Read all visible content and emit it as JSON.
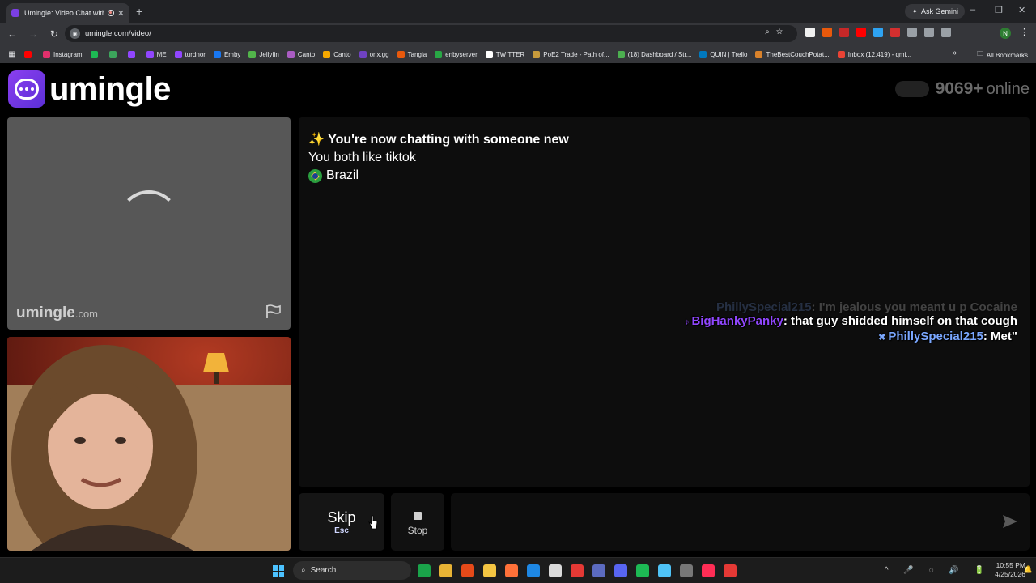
{
  "browser": {
    "tab_title": "Umingle: Video Chat with S",
    "new_tab": "+",
    "ask_gemini": "Ask Gemini",
    "url": "umingle.com/video/",
    "bookmarks": [
      {
        "label": "Instagram",
        "color": "#e1306c"
      },
      {
        "label": "",
        "color": "#1db954"
      },
      {
        "label": "",
        "color": "#3ca55c"
      },
      {
        "label": "",
        "color": "#9146ff"
      },
      {
        "label": "ME",
        "color": "#9146ff"
      },
      {
        "label": "turdnor",
        "color": "#9146ff"
      },
      {
        "label": "Emby",
        "color": "#1877f2"
      },
      {
        "label": "Jellyfin",
        "color": "#52b54b"
      },
      {
        "label": "Canto",
        "color": "#aa5cc3"
      },
      {
        "label": "Canto",
        "color": "#f6a800"
      },
      {
        "label": "onx.gg",
        "color": "#6f42c1"
      },
      {
        "label": "Tangia",
        "color": "#e8590c"
      },
      {
        "label": "enbyserver",
        "color": "#28a745"
      },
      {
        "label": "TWITTER",
        "color": "#ffffff"
      },
      {
        "label": "PoE2 Trade - Path of...",
        "color": "#c89b3c"
      },
      {
        "label": "(18) Dashboard / Str...",
        "color": "#4caf50"
      },
      {
        "label": "QUIN | Trello",
        "color": "#0079bf"
      },
      {
        "label": "TheBestCouchPotat...",
        "color": "#d9822b"
      },
      {
        "label": "Inbox (12,419) - qmi...",
        "color": "#ea4335"
      }
    ],
    "all_bookmarks": "All Bookmarks"
  },
  "header": {
    "logo_text": "umingle",
    "online_count": "9069+",
    "online_label": "online"
  },
  "remote_video": {
    "watermark": "umingle",
    "watermark_domain": ".com"
  },
  "chat": {
    "system_lines": [
      "✨ You're now chatting with someone new",
      "You both like tiktok",
      "Brazil"
    ],
    "overlay_messages": [
      {
        "user": "PhillySpecial215",
        "text": ": I'm jealous you meant u p Cocaine",
        "faded": true
      },
      {
        "user": "BigHankyPanky",
        "text": ": that guy shidded himself on that cough",
        "faded": false
      },
      {
        "user": "PhillySpecial215",
        "text": ": Met\"",
        "faded": false
      }
    ]
  },
  "controls": {
    "skip_label": "Skip",
    "skip_key": "Esc",
    "stop_label": "Stop",
    "message_placeholder": ""
  },
  "taskbar": {
    "search_label": "Search",
    "time": "10:55 PM",
    "date": "4/25/2026",
    "tray_icons": "^ 🎤 ◌ 🔊 🔋"
  },
  "colors": {
    "brand_purple": "#7b3fe4",
    "username_purple": "#9147ff",
    "username_blue": "#7aa7ff",
    "chat_panel_bg": "#0d0d0d"
  }
}
